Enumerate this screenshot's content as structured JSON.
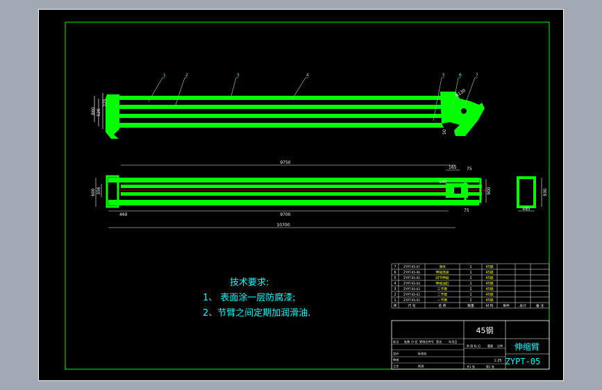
{
  "app": {
    "canvas_color": "#a3a9b4",
    "sheet_color": "#000000"
  },
  "colors": {
    "part": "#00ff00",
    "dim": "#ffffff",
    "leader": "#7fff7f",
    "text": "#00ffff",
    "titleblock": "#ffffff",
    "centerline": "#ff0000",
    "accent": "#ffff00",
    "frame": "#00ff00"
  },
  "side_view": {
    "balloons": [
      "1",
      "2",
      "3",
      "4",
      "5",
      "6",
      "7"
    ],
    "dims": {
      "overall_height": "860",
      "upper": "520",
      "top": "225",
      "right_small": "50",
      "tip": "R130"
    }
  },
  "plan_view": {
    "dims": {
      "top_length": "9750",
      "right_a": "165",
      "right_b": "75",
      "right_c": "100",
      "left_h": "600",
      "left_h2": "356",
      "right_h": "900",
      "bottom_a": "460",
      "bottom_b": "9700",
      "bottom_c": "75",
      "overall": "10700"
    }
  },
  "section": {
    "width": "485",
    "height": "930"
  },
  "notes": {
    "heading": "技术要求:",
    "items": [
      "1、 表面涂一层防腐漆;",
      "2、节臂之间定期加润滑油."
    ]
  },
  "bom": {
    "rows": [
      {
        "no": "7",
        "code": "ZYPT-05-07",
        "name": "滑块",
        "qty": "1",
        "material": "45钢"
      },
      {
        "no": "6",
        "code": "ZYPT-05-06",
        "name": "伸缩连接",
        "qty": "1",
        "material": "45钢"
      },
      {
        "no": "5",
        "code": "ZYPT-05-05",
        "name": "四节伸缩",
        "qty": "1",
        "material": "45钢"
      },
      {
        "no": "4",
        "code": "ZYPT-05-04",
        "name": "伸缩油缸",
        "qty": "1",
        "material": "45钢"
      },
      {
        "no": "3",
        "code": "ZYPT-05-03",
        "name": "三节臂",
        "qty": "1",
        "material": "45钢"
      },
      {
        "no": "2",
        "code": "ZYPT-05-02",
        "name": "二节臂",
        "qty": "1",
        "material": "45钢"
      },
      {
        "no": "1",
        "code": "ZYPT-05-01",
        "name": "一节臂",
        "qty": "1",
        "material": "45钢"
      }
    ],
    "header": [
      "序",
      "代 号",
      "名 称",
      "数量",
      "材 料",
      "单件",
      "总计",
      "备 注"
    ]
  },
  "title_block": {
    "material": "45钢",
    "part_name": "伸缩臂",
    "drawing_no": "ZYPT-05",
    "scale": "1:25",
    "row_labels": [
      "标记",
      "处数",
      "分 区",
      "更改文件号",
      "签名",
      "年月日"
    ],
    "row_labels2": [
      "设计",
      "标准化"
    ],
    "row_labels3": [
      "审核"
    ],
    "row_labels4": [
      "工艺",
      "批准"
    ],
    "stage_labels": [
      "阶 段 标 记",
      "重量",
      "比例"
    ],
    "sheet_info": [
      "共1 张",
      "第1 张"
    ]
  }
}
